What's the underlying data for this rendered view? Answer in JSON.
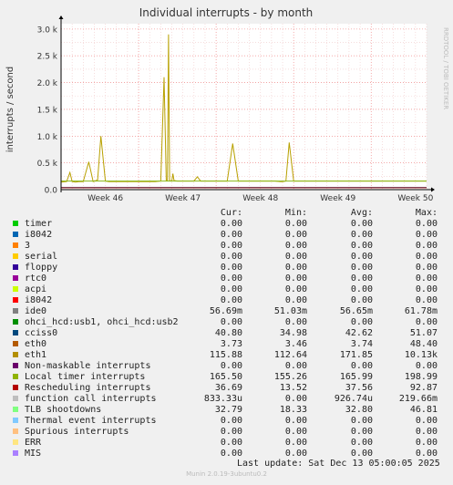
{
  "chart_data": {
    "type": "line",
    "title": "Individual interrupts - by month",
    "ylabel": "interrupts / second",
    "side_label": "RRDTOOL / TOBI OETIKER",
    "ylim": [
      0,
      3100
    ],
    "yticks": [
      {
        "v": 0,
        "label": "0.0"
      },
      {
        "v": 500,
        "label": "0.5 k"
      },
      {
        "v": 1000,
        "label": "1.0 k"
      },
      {
        "v": 1500,
        "label": "1.5 k"
      },
      {
        "v": 2000,
        "label": "2.0 k"
      },
      {
        "v": 2500,
        "label": "2.5 k"
      },
      {
        "v": 3000,
        "label": "3.0 k"
      }
    ],
    "xlim": [
      0,
      33
    ],
    "xticks": [
      {
        "x": 4,
        "label": "Week 46"
      },
      {
        "x": 11,
        "label": "Week 47"
      },
      {
        "x": 18,
        "label": "Week 48"
      },
      {
        "x": 25,
        "label": "Week 49"
      },
      {
        "x": 32,
        "label": "Week 50"
      }
    ],
    "series": [
      {
        "name": "eth1",
        "color": "#b8a000",
        "x": [
          0,
          0.5,
          0.8,
          1.0,
          1.3,
          1.6,
          2.0,
          2.5,
          2.9,
          3.3,
          3.6,
          4.0,
          4.3,
          4.6,
          5.0,
          5.5,
          6.0,
          6.5,
          7.0,
          7.3,
          7.6,
          8.0,
          8.5,
          9.0,
          9.3,
          9.5,
          9.6,
          9.7,
          9.8,
          10.0,
          10.1,
          10.2,
          10.5,
          11.0,
          11.5,
          11.8,
          12.0,
          12.3,
          12.6,
          13.0,
          13.3,
          13.5,
          14.0,
          14.3,
          14.5,
          15.0,
          15.5,
          16.0,
          16.5,
          17.0,
          17.5,
          17.7,
          17.9,
          18.5,
          18.8,
          19.0,
          19.3,
          19.8,
          20.0,
          20.3,
          20.6,
          21.0,
          21.2,
          21.4,
          21.8,
          22.5,
          23.5,
          24.5,
          25.0,
          25.2,
          25.4,
          25.8,
          26.0,
          26.4,
          26.8,
          27.0,
          27.5,
          28.0,
          28.3,
          28.6,
          29.0,
          29.5,
          30.0,
          30.5,
          31.0,
          31.3,
          31.5,
          31.7,
          32.0,
          32.2,
          32.3,
          32.4,
          32.6,
          33.0
        ],
        "y": [
          140,
          150,
          320,
          150,
          140,
          150,
          150,
          520,
          150,
          180,
          1000,
          160,
          150,
          150,
          150,
          150,
          150,
          150,
          150,
          150,
          150,
          150,
          150,
          160,
          2100,
          170,
          170,
          2900,
          170,
          160,
          300,
          170,
          160,
          160,
          160,
          160,
          160,
          240,
          160,
          160,
          160,
          160,
          160,
          160,
          160,
          160,
          860,
          160,
          160,
          160,
          160,
          160,
          160,
          160,
          160,
          160,
          160,
          150,
          150,
          160,
          880,
          160,
          160,
          160,
          160,
          160,
          160,
          160,
          160,
          160,
          160,
          160,
          160,
          160,
          160,
          160,
          160,
          160,
          160,
          160,
          160,
          160,
          160,
          160,
          160,
          160,
          160,
          160,
          160,
          160,
          160,
          160,
          160,
          160
        ]
      },
      {
        "name": "Local timer interrupts",
        "color": "#88b818",
        "x": [
          0,
          33
        ],
        "y": [
          160,
          160
        ]
      }
    ]
  },
  "legend": {
    "headers": {
      "cur": "Cur:",
      "min": "Min:",
      "avg": "Avg:",
      "max": "Max:"
    },
    "rows": [
      {
        "name": "timer",
        "color": "#00cc00",
        "cur": "0.00",
        "min": "0.00",
        "avg": "0.00",
        "max": "0.00"
      },
      {
        "name": "i8042",
        "color": "#0066b3",
        "cur": "0.00",
        "min": "0.00",
        "avg": "0.00",
        "max": "0.00"
      },
      {
        "name": "3",
        "color": "#ff8000",
        "cur": "0.00",
        "min": "0.00",
        "avg": "0.00",
        "max": "0.00"
      },
      {
        "name": "serial",
        "color": "#ffcc00",
        "cur": "0.00",
        "min": "0.00",
        "avg": "0.00",
        "max": "0.00"
      },
      {
        "name": "floppy",
        "color": "#330099",
        "cur": "0.00",
        "min": "0.00",
        "avg": "0.00",
        "max": "0.00"
      },
      {
        "name": "rtc0",
        "color": "#990099",
        "cur": "0.00",
        "min": "0.00",
        "avg": "0.00",
        "max": "0.00"
      },
      {
        "name": "acpi",
        "color": "#ccff00",
        "cur": "0.00",
        "min": "0.00",
        "avg": "0.00",
        "max": "0.00"
      },
      {
        "name": "i8042",
        "color": "#ff0000",
        "cur": "0.00",
        "min": "0.00",
        "avg": "0.00",
        "max": "0.00"
      },
      {
        "name": "ide0",
        "color": "#808080",
        "cur": "56.69m",
        "min": "51.03m",
        "avg": "56.65m",
        "max": "61.78m"
      },
      {
        "name": "ohci_hcd:usb1, ohci_hcd:usb2",
        "color": "#008f00",
        "cur": "0.00",
        "min": "0.00",
        "avg": "0.00",
        "max": "0.00"
      },
      {
        "name": "cciss0",
        "color": "#00487d",
        "cur": "40.80",
        "min": "34.98",
        "avg": "42.62",
        "max": "51.07"
      },
      {
        "name": "eth0",
        "color": "#b35a00",
        "cur": "3.73",
        "min": "3.46",
        "avg": "3.74",
        "max": "48.40"
      },
      {
        "name": "eth1",
        "color": "#b38f00",
        "cur": "115.88",
        "min": "112.64",
        "avg": "171.85",
        "max": "10.13k"
      },
      {
        "name": "Non-maskable interrupts",
        "color": "#6b006b",
        "cur": "0.00",
        "min": "0.00",
        "avg": "0.00",
        "max": "0.00"
      },
      {
        "name": "Local timer interrupts",
        "color": "#8fb300",
        "cur": "165.50",
        "min": "155.26",
        "avg": "165.99",
        "max": "198.99"
      },
      {
        "name": "Rescheduling interrupts",
        "color": "#b30000",
        "cur": "36.69",
        "min": "13.52",
        "avg": "37.56",
        "max": "92.87"
      },
      {
        "name": "function call interrupts",
        "color": "#bebebe",
        "cur": "833.33u",
        "min": "0.00",
        "avg": "926.74u",
        "max": "219.66m"
      },
      {
        "name": "TLB shootdowns",
        "color": "#80ff80",
        "cur": "32.79",
        "min": "18.33",
        "avg": "32.80",
        "max": "46.81"
      },
      {
        "name": "Thermal event interrupts",
        "color": "#80c9ff",
        "cur": "0.00",
        "min": "0.00",
        "avg": "0.00",
        "max": "0.00"
      },
      {
        "name": "Spurious interrupts",
        "color": "#ffc080",
        "cur": "0.00",
        "min": "0.00",
        "avg": "0.00",
        "max": "0.00"
      },
      {
        "name": "ERR",
        "color": "#ffe680",
        "cur": "0.00",
        "min": "0.00",
        "avg": "0.00",
        "max": "0.00"
      },
      {
        "name": "MIS",
        "color": "#aa80ff",
        "cur": "0.00",
        "min": "0.00",
        "avg": "0.00",
        "max": "0.00"
      }
    ]
  },
  "last_update": "Last update:  Sat Dec 13 05:00:05 2025",
  "footer": "Munin 2.0.19-3ubuntu0.2"
}
